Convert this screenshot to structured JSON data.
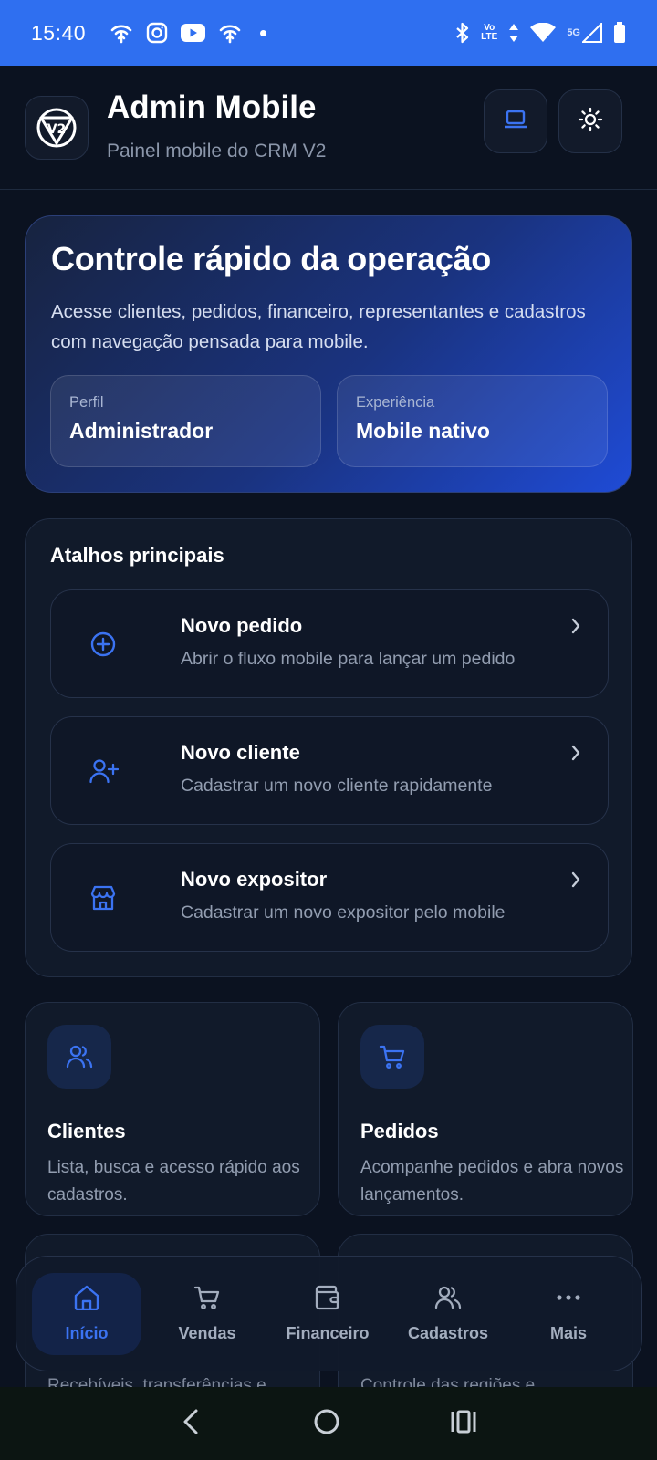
{
  "status_bar": {
    "time": "15:40",
    "lte_top": "Vo",
    "lte_bottom": "LTE",
    "network": "5G",
    "icons_left": [
      "wifi-calling-icon",
      "instagram-icon",
      "youtube-icon",
      "wifi-calling-icon",
      "dot-icon"
    ],
    "icons_right": [
      "bluetooth-icon",
      "volte-icon",
      "data-arrows-icon",
      "wifi-icon",
      "signal-icon",
      "battery-icon"
    ]
  },
  "header": {
    "title": "Admin Mobile",
    "subtitle": "Painel mobile do CRM V2",
    "logo_text": "V2",
    "buttons": [
      "laptop-icon",
      "sun-icon"
    ]
  },
  "hero": {
    "title": "Controle rápido da operação",
    "description": "Acesse clientes, pedidos, financeiro, representantes e cadastros com navegação pensada para mobile.",
    "cards": [
      {
        "label": "Perfil",
        "value": "Administrador"
      },
      {
        "label": "Experiência",
        "value": "Mobile nativo"
      }
    ]
  },
  "shortcuts": {
    "title": "Atalhos principais",
    "items": [
      {
        "title": "Novo pedido",
        "description": "Abrir o fluxo mobile para lançar um pedido",
        "icon": "plus-circle-icon"
      },
      {
        "title": "Novo cliente",
        "description": "Cadastrar um novo cliente rapidamente",
        "icon": "user-plus-icon"
      },
      {
        "title": "Novo expositor",
        "description": "Cadastrar um novo expositor pelo mobile",
        "icon": "store-icon"
      }
    ]
  },
  "modules": [
    {
      "title": "Clientes",
      "description": "Lista, busca e acesso rápido aos cadastros.",
      "icon": "users-icon"
    },
    {
      "title": "Pedidos",
      "description": "Acompanhe pedidos e abra novos lançamentos.",
      "icon": "cart-icon"
    },
    {
      "description": "Recebíveis, transferências e",
      "icon": ""
    },
    {
      "description": "Controle das regiões e",
      "icon": ""
    }
  ],
  "bottom_nav": {
    "active_index": 0,
    "items": [
      {
        "label": "Início",
        "icon": "home-icon"
      },
      {
        "label": "Vendas",
        "icon": "cart-icon"
      },
      {
        "label": "Financeiro",
        "icon": "wallet-icon"
      },
      {
        "label": "Cadastros",
        "icon": "users-icon"
      },
      {
        "label": "Mais",
        "icon": "more-icon"
      }
    ]
  },
  "system_nav": [
    "back-icon",
    "home-circle-icon",
    "recents-icon"
  ],
  "colors": {
    "background": "#0b1220",
    "status_bar": "#2f6ff0",
    "accent": "#3b73f2",
    "card": "#111a2a",
    "muted_text": "#929db0"
  }
}
